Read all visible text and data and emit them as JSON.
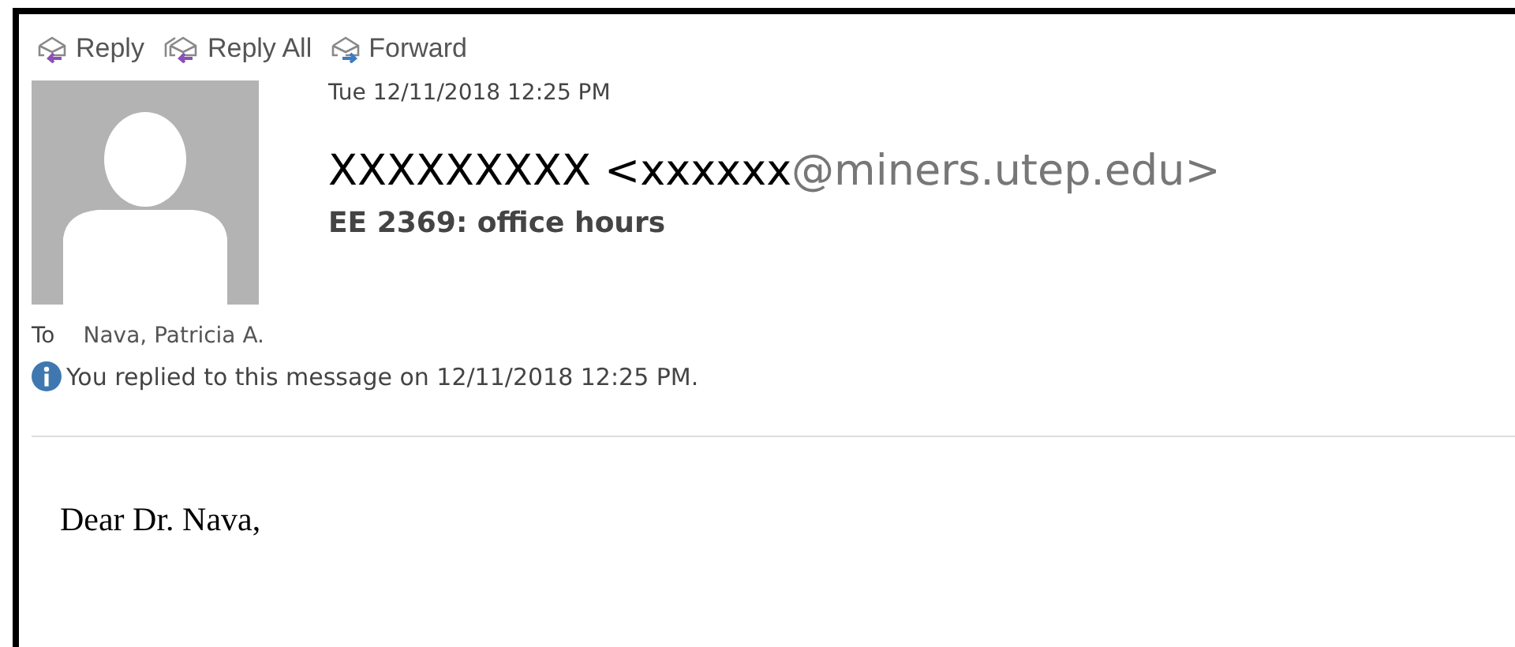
{
  "toolbar": [
    {
      "label": "Reply",
      "kind": "reply"
    },
    {
      "label": "Reply All",
      "kind": "reply_all"
    },
    {
      "label": "Forward",
      "kind": "forward"
    }
  ],
  "message": {
    "date": "Tue 12/11/2018 12:25 PM",
    "sender_name": "XXXXXXXXX <xxxxxx",
    "sender_domain": "@miners.utep.edu>",
    "subject": "EE 2369: office hours",
    "to_label": "To",
    "to": "Nava, Patricia A.",
    "info": "You replied to this message on 12/11/2018 12:25 PM."
  },
  "body": [
    "Dear Dr. Nava,"
  ]
}
